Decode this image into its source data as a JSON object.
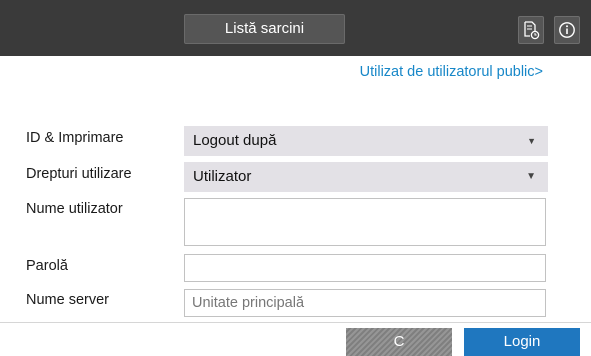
{
  "topbar": {
    "task_list_label": "Listă sarcini",
    "icons": [
      "job-status-icon",
      "info-icon"
    ],
    "background": "#3a3a3a"
  },
  "public_user_link": "Utilizat de utilizatorul public>",
  "form": {
    "id_print": {
      "label": "ID & Imprimare",
      "value": "Logout după"
    },
    "user_rights": {
      "label": "Drepturi utilizare",
      "value": "Utilizator"
    },
    "user_name": {
      "label": "Nume utilizator",
      "value": ""
    },
    "password": {
      "label": "Parolă",
      "value": ""
    },
    "server_name": {
      "label": "Nume server",
      "placeholder": "Unitate principală"
    }
  },
  "footer": {
    "clear_label": "C",
    "login_label": "Login"
  },
  "colors": {
    "accent": "#1f77bf",
    "link": "#1787c8",
    "select_bg": "#e3e1e6"
  }
}
